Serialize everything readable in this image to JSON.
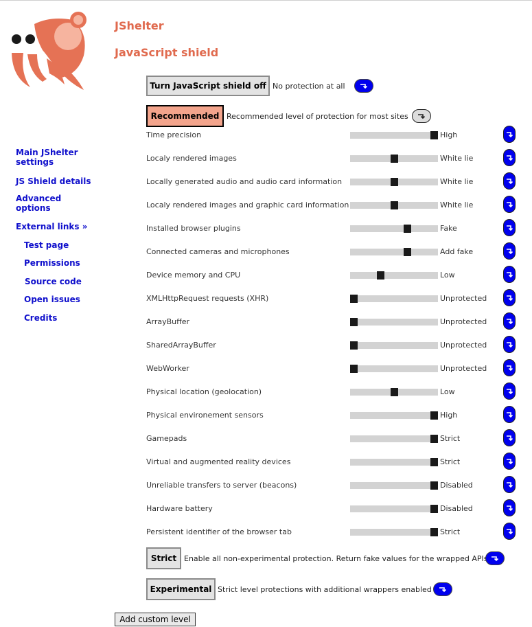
{
  "app_title": "JShelter",
  "page_title": "JavaScript shield",
  "nav": [
    {
      "label": "Main JShelter settings",
      "sub": false
    },
    {
      "label": "JS Shield details",
      "sub": false
    },
    {
      "label": "Advanced options",
      "sub": false
    },
    {
      "label": "External links »",
      "sub": false
    },
    {
      "label": "Test page",
      "sub": true
    },
    {
      "label": "Permissions",
      "sub": true
    },
    {
      "label": "Source code",
      "sub": true
    },
    {
      "label": "Open issues",
      "sub": true
    },
    {
      "label": "Credits",
      "sub": true
    }
  ],
  "levels": {
    "off": {
      "label": "Turn JavaScript shield off",
      "description": "No protection at all"
    },
    "recommended": {
      "label": "Recommended",
      "description": "Recommended level of protection for most sites"
    },
    "strict": {
      "label": "Strict",
      "description": "Enable all non-experimental protection. Return fake values for the wrapped APIs"
    },
    "experimental": {
      "label": "Experimental",
      "description": "Strict level protections with additional wrappers enabled"
    }
  },
  "settings": [
    {
      "label": "Time precision",
      "value": "High",
      "level_fraction": 1.0
    },
    {
      "label": "Localy rendered images",
      "value": "White lie",
      "level_fraction": 0.5
    },
    {
      "label": "Locally generated audio and audio card information",
      "value": "White lie",
      "level_fraction": 0.5
    },
    {
      "label": "Localy rendered images and graphic card information",
      "value": "White lie",
      "level_fraction": 0.5
    },
    {
      "label": "Installed browser plugins",
      "value": "Fake",
      "level_fraction": 0.667
    },
    {
      "label": "Connected cameras and microphones",
      "value": "Add fake",
      "level_fraction": 0.667
    },
    {
      "label": "Device memory and CPU",
      "value": "Low",
      "level_fraction": 0.333
    },
    {
      "label": "XMLHttpRequest requests (XHR)",
      "value": "Unprotected",
      "level_fraction": 0.0
    },
    {
      "label": "ArrayBuffer",
      "value": "Unprotected",
      "level_fraction": 0.0
    },
    {
      "label": "SharedArrayBuffer",
      "value": "Unprotected",
      "level_fraction": 0.0
    },
    {
      "label": "WebWorker",
      "value": "Unprotected",
      "level_fraction": 0.0
    },
    {
      "label": "Physical location (geolocation)",
      "value": "Low",
      "level_fraction": 0.5
    },
    {
      "label": "Physical environement sensors",
      "value": "High",
      "level_fraction": 1.0
    },
    {
      "label": "Gamepads",
      "value": "Strict",
      "level_fraction": 1.0
    },
    {
      "label": "Virtual and augmented reality devices",
      "value": "Strict",
      "level_fraction": 1.0
    },
    {
      "label": "Unreliable transfers to server (beacons)",
      "value": "Disabled",
      "level_fraction": 1.0
    },
    {
      "label": "Hardware battery",
      "value": "Disabled",
      "level_fraction": 1.0
    },
    {
      "label": "Persistent identifier of the browser tab",
      "value": "Strict",
      "level_fraction": 1.0
    }
  ],
  "add_custom_label": "Add custom level",
  "colors": {
    "brand": "#e06a4e",
    "help_blue": "#0000ee",
    "recommended_bg": "#f3a48c",
    "link": "#1010cc"
  },
  "icons": {
    "logo": "jshelter-crab-logo",
    "help": "help-arrow-icon"
  }
}
